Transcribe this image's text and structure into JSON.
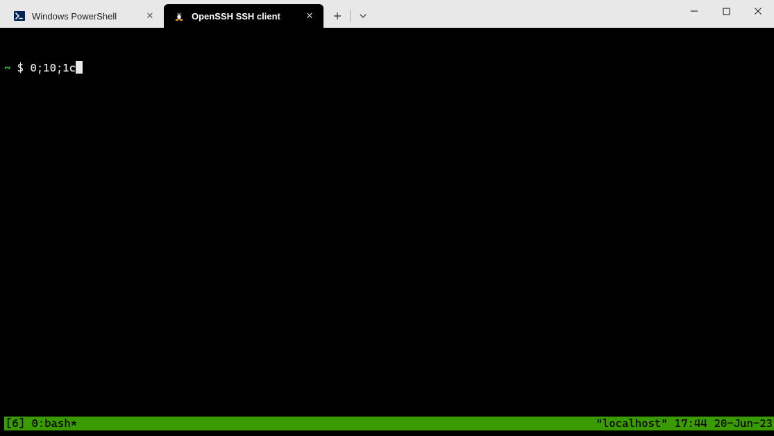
{
  "tabs": [
    {
      "label": "Windows PowerShell",
      "icon": "powershell-icon",
      "active": false
    },
    {
      "label": "OpenSSH SSH client",
      "icon": "tux-icon",
      "active": true
    }
  ],
  "terminal": {
    "prompt_path": "~",
    "prompt_symbol": "$",
    "command": "0;10;1c"
  },
  "status": {
    "left": "[6] 0:bash*",
    "host": "\"localhost\"",
    "time": "17:44",
    "date": "20-Jun-23"
  },
  "glyphs": {
    "close": "✕",
    "plus": "＋",
    "chevron": "⌄"
  }
}
